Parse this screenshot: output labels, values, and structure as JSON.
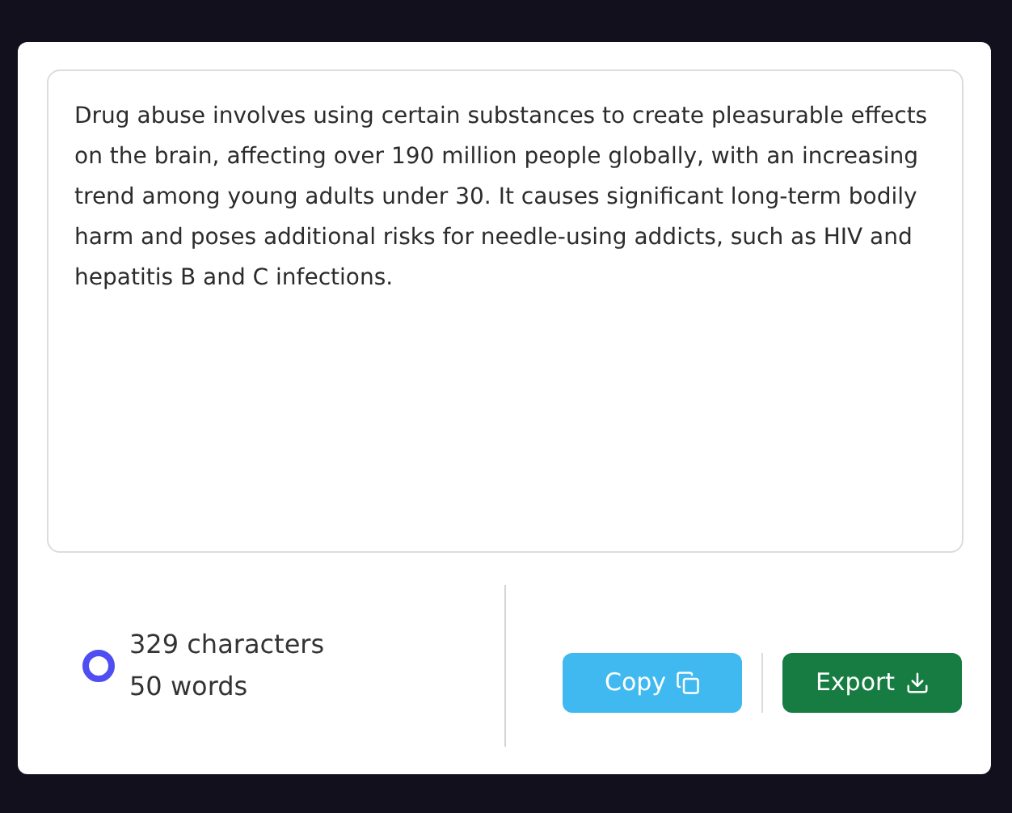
{
  "editor": {
    "value": "Drug abuse involves using certain substances to create pleasurable effects on the brain, affecting over 190 million people globally, with an increasing trend among young adults under 30. It causes significant long-term bodily harm and poses additional risks for needle-using addicts, such as HIV and hepatitis B and C infections."
  },
  "stats": {
    "characters": "329 characters",
    "words": "50 words"
  },
  "buttons": [
    {
      "kind": "copy",
      "label": "Copy"
    },
    {
      "kind": "export",
      "label": "Export"
    }
  ]
}
